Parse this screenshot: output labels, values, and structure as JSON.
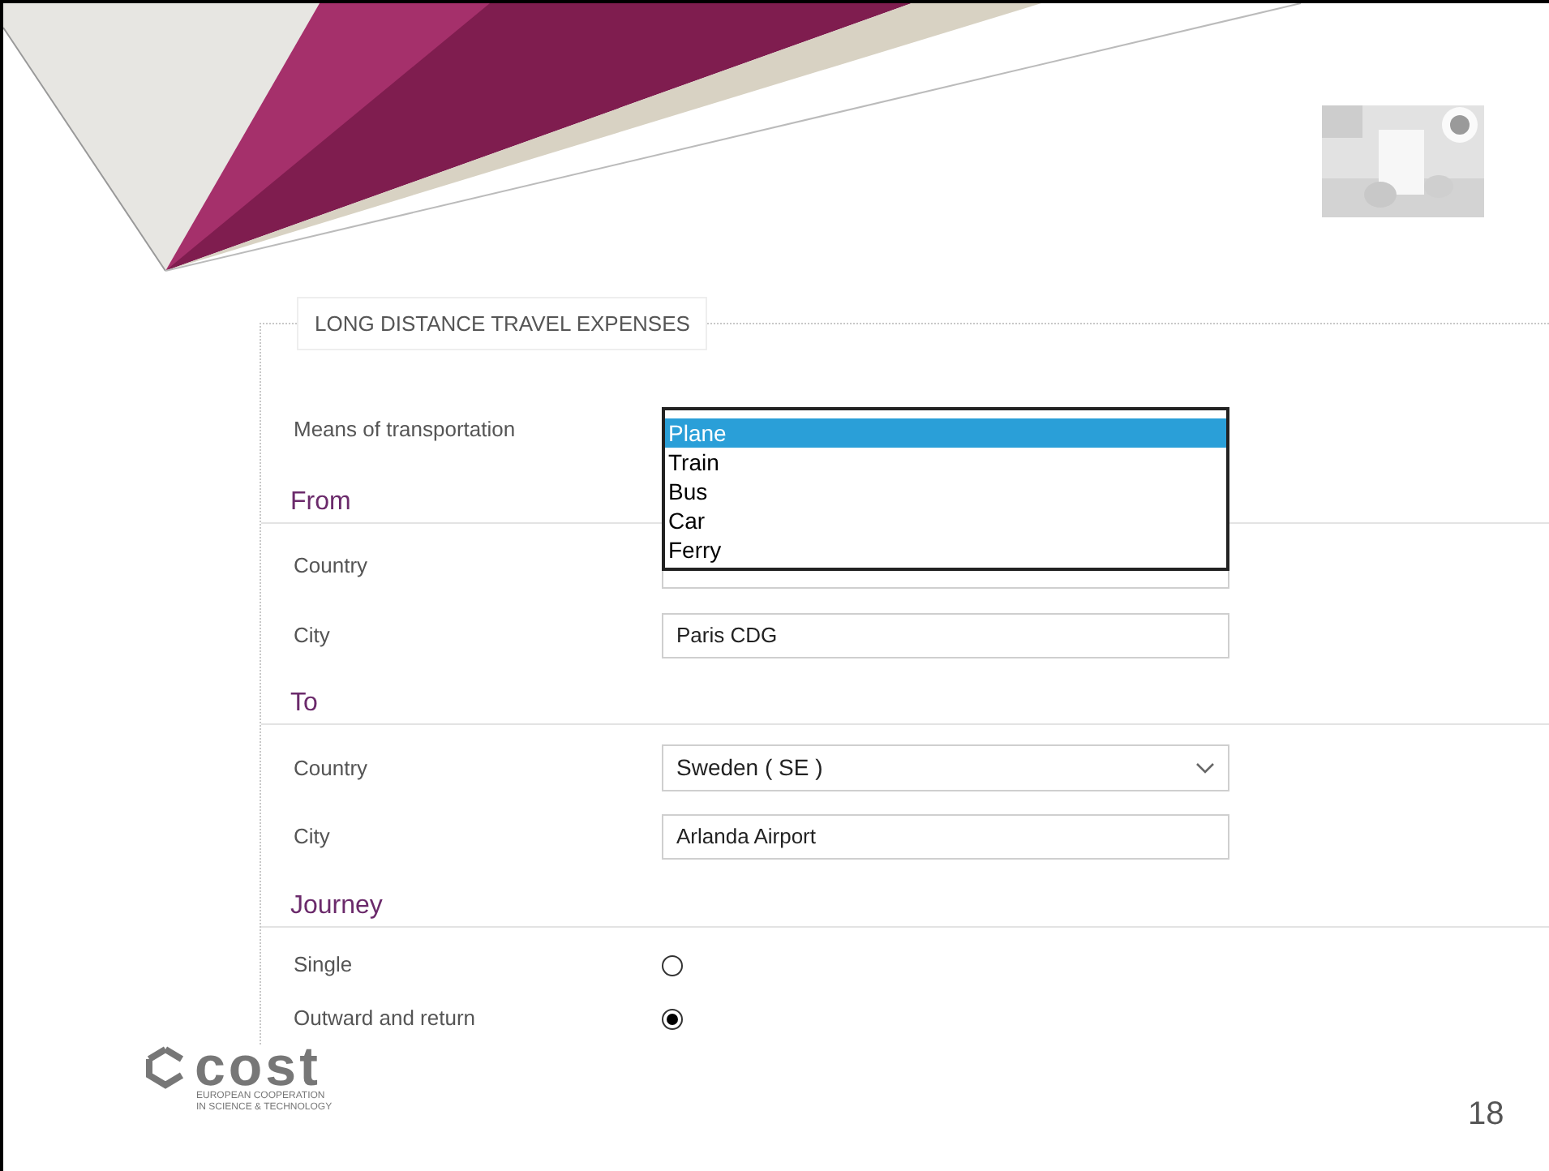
{
  "section_title": "LONG DISTANCE TRAVEL EXPENSES",
  "transport": {
    "label": "Means of transportation",
    "options": [
      {
        "label": "Plane",
        "selected": true
      },
      {
        "label": "Train",
        "selected": false
      },
      {
        "label": "Bus",
        "selected": false
      },
      {
        "label": "Car",
        "selected": false
      },
      {
        "label": "Ferry",
        "selected": false
      }
    ]
  },
  "from": {
    "heading": "From",
    "fields": [
      {
        "kind": "select",
        "label": "Country"
      },
      {
        "kind": "text",
        "label": "City",
        "value": "Paris CDG"
      }
    ]
  },
  "to": {
    "heading": "To",
    "fields": [
      {
        "kind": "select",
        "label": "Country",
        "value": "Sweden ( SE )"
      },
      {
        "kind": "text",
        "label": "City",
        "value": "Arlanda Airport"
      }
    ]
  },
  "journey": {
    "heading": "Journey",
    "options": [
      {
        "label": "Single",
        "selected": false
      },
      {
        "label": "Outward and return",
        "selected": true
      }
    ]
  },
  "footer": {
    "logo_text": "cost",
    "logo_tagline": [
      "EUROPEAN COOPERATION",
      "IN SCIENCE & TECHNOLOGY"
    ],
    "page_number": "18"
  }
}
